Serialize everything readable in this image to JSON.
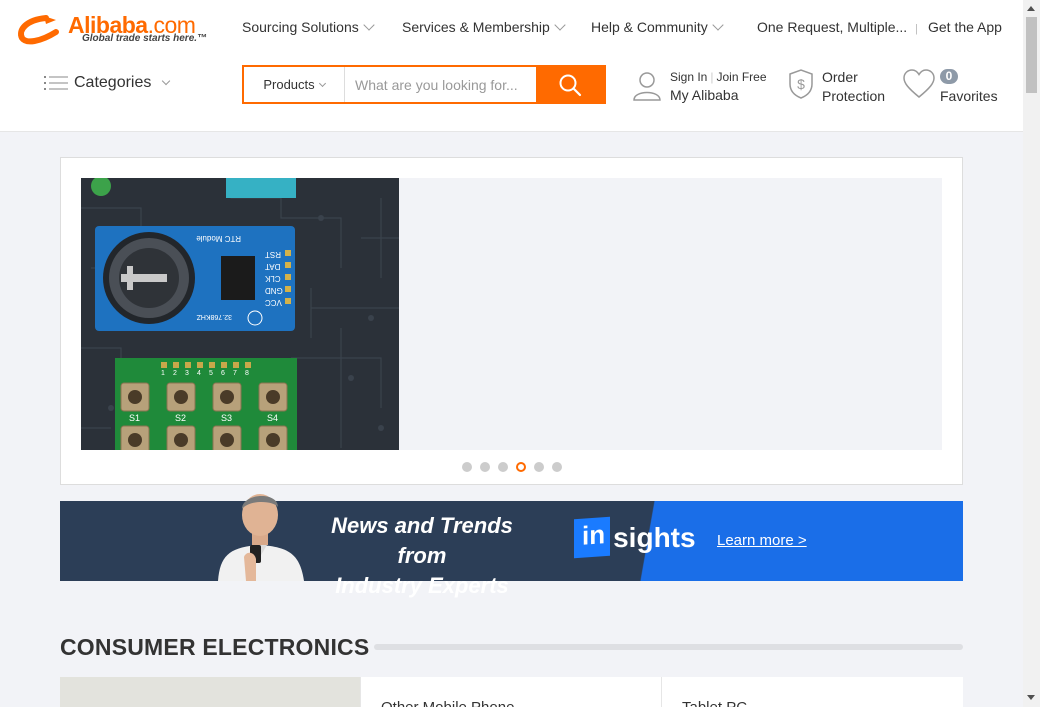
{
  "logo": {
    "brand": "Alibaba",
    "tld": ".com",
    "tagline": "Global trade starts here.™"
  },
  "topnav": {
    "sourcing": "Sourcing Solutions",
    "services": "Services & Membership",
    "help": "Help & Community",
    "one_request": "One Request, Multiple...",
    "separator": "|",
    "get_app": "Get the App"
  },
  "categories_label": "Categories",
  "search": {
    "scope": "Products",
    "placeholder": "What are you looking for..."
  },
  "account": {
    "sign_in": "Sign In",
    "join": "Join Free",
    "divider": "|",
    "my_alibaba": "My Alibaba"
  },
  "order_protection": {
    "line1": "Order",
    "line2": "Protection"
  },
  "favorites": {
    "count": "0",
    "label": "Favorites"
  },
  "carousel": {
    "slide_texts": [
      "RTC Module",
      "RST",
      "DAT",
      "CLK",
      "GND",
      "VCC",
      "S1",
      "S2",
      "S3",
      "S4",
      "1",
      "2",
      "3",
      "4",
      "5",
      "6",
      "7",
      "8",
      "32.768KHZ"
    ],
    "dot_count": 6,
    "active_dot": 4
  },
  "insights_banner": {
    "headline_line1": "News and Trends from",
    "headline_line2": "Industry Experts",
    "logo_in": "in",
    "logo_rest": "sights",
    "learn_more": "Learn more >"
  },
  "section": {
    "title": "CONSUMER ELECTRONICS",
    "cards": [
      "Other Mobile Phone",
      "Tablet PC"
    ]
  },
  "colors": {
    "accent": "#ff6a00",
    "banner_dark": "#2c3e57",
    "banner_blue": "#1a6ee8"
  }
}
